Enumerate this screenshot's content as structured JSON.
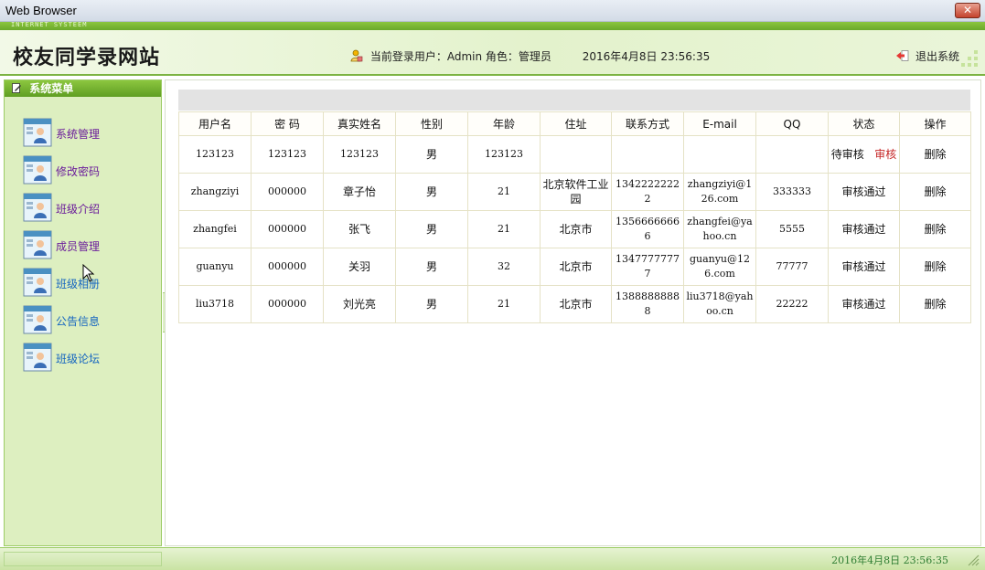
{
  "window": {
    "title": "Web Browser",
    "close_glyph": "✕"
  },
  "strip": {
    "text": "INTERNET SYSTEEM"
  },
  "header": {
    "site_title": "校友同学录网站",
    "user_label": "当前登录用户：Admin 角色：管理员",
    "datetime": "2016年4月8日  23:56:35",
    "logout_label": "退出系统",
    "user_icon": "user-lock-icon",
    "logout_icon": "exit-arrow-icon"
  },
  "sidebar": {
    "header": "系统菜单",
    "items": [
      {
        "label": "系统管理",
        "icon": "user-card-icon"
      },
      {
        "label": "修改密码",
        "icon": "user-card-icon"
      },
      {
        "label": "班级介绍",
        "icon": "user-card-icon"
      },
      {
        "label": "成员管理",
        "icon": "user-card-icon"
      },
      {
        "label": "班级相册",
        "icon": "user-card-icon"
      },
      {
        "label": "公告信息",
        "icon": "user-card-icon"
      },
      {
        "label": "班级论坛",
        "icon": "user-card-icon"
      }
    ]
  },
  "table": {
    "headers": [
      "用户名",
      "密 码",
      "真实姓名",
      "性别",
      "年龄",
      "住址",
      "联系方式",
      "E-mail",
      "QQ",
      "状态",
      "操作"
    ],
    "rows": [
      {
        "username": "123123",
        "password": "123123",
        "realname": "123123",
        "gender": "男",
        "age": "123123",
        "address": "",
        "phone": "",
        "email": "",
        "qq": "",
        "status": "待审核",
        "status_action": "审核",
        "action": "删除"
      },
      {
        "username": "zhangziyi",
        "password": "000000",
        "realname": "章子怡",
        "gender": "男",
        "age": "21",
        "address": "北京软件工业园",
        "phone": "13422222222",
        "email": "zhangziyi@126.com",
        "qq": "333333",
        "status": "审核通过",
        "status_action": "",
        "action": "删除"
      },
      {
        "username": "zhangfei",
        "password": "000000",
        "realname": "张飞",
        "gender": "男",
        "age": "21",
        "address": "北京市",
        "phone": "13566666666",
        "email": "zhangfei@yahoo.cn",
        "qq": "5555",
        "status": "审核通过",
        "status_action": "",
        "action": "删除"
      },
      {
        "username": "guanyu",
        "password": "000000",
        "realname": "关羽",
        "gender": "男",
        "age": "32",
        "address": "北京市",
        "phone": "13477777777",
        "email": "guanyu@126.com",
        "qq": "77777",
        "status": "审核通过",
        "status_action": "",
        "action": "删除"
      },
      {
        "username": "liu3718",
        "password": "000000",
        "realname": "刘光亮",
        "gender": "男",
        "age": "21",
        "address": "北京市",
        "phone": "13888888888",
        "email": "liu3718@yahoo.cn",
        "qq": "22222",
        "status": "审核通过",
        "status_action": "",
        "action": "删除"
      }
    ]
  },
  "statusbar": {
    "datetime": "2016年4月8日  23:56:35"
  },
  "colors": {
    "accent_green": "#7cb342",
    "menu_purple": "#6a1b9a",
    "menu_blue": "#1565c0",
    "status_red": "#c62828"
  }
}
